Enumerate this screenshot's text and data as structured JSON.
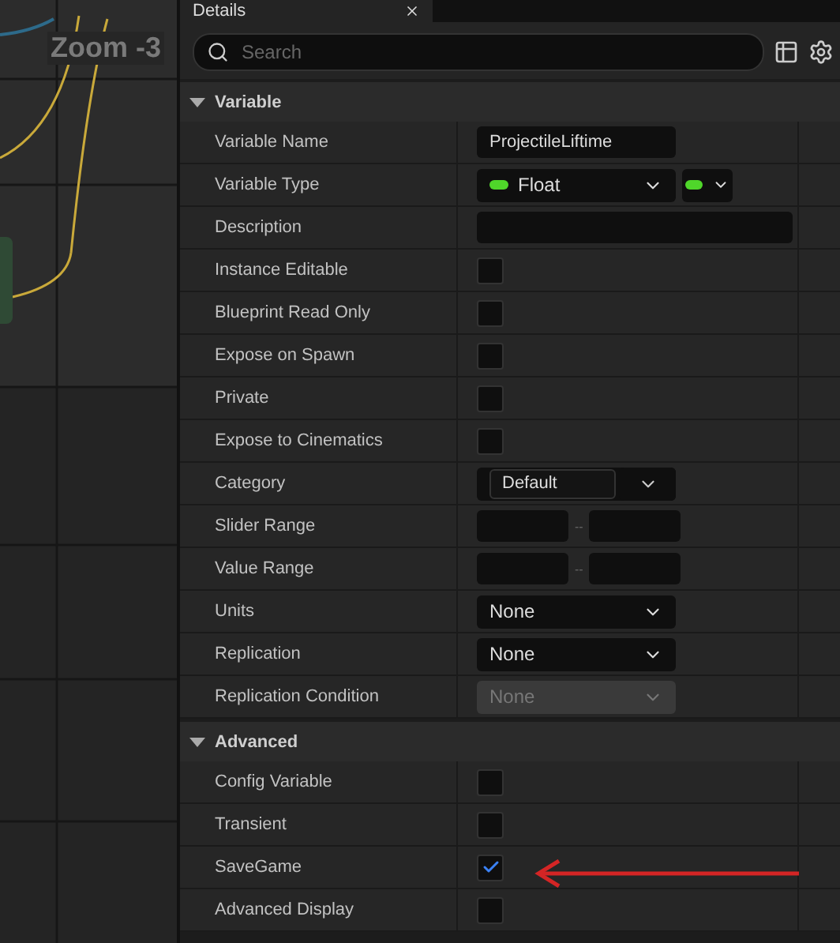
{
  "graph": {
    "zoom_label": "Zoom -3"
  },
  "tab": {
    "title": "Details"
  },
  "search": {
    "placeholder": "Search"
  },
  "sections": [
    {
      "title": "Variable",
      "expanded": true,
      "rows": [
        {
          "label": "Variable Name",
          "kind": "text",
          "value": "ProjectileLiftime"
        },
        {
          "label": "Variable Type",
          "kind": "type",
          "value": "Float",
          "color": "#4fd62a"
        },
        {
          "label": "Description",
          "kind": "wide"
        },
        {
          "label": "Instance Editable",
          "kind": "checkbox",
          "checked": false
        },
        {
          "label": "Blueprint Read Only",
          "kind": "checkbox",
          "checked": false
        },
        {
          "label": "Expose on Spawn",
          "kind": "checkbox",
          "checked": false
        },
        {
          "label": "Private",
          "kind": "checkbox",
          "checked": false
        },
        {
          "label": "Expose to Cinematics",
          "kind": "checkbox",
          "checked": false
        },
        {
          "label": "Category",
          "kind": "combo",
          "value": "Default"
        },
        {
          "label": "Slider Range",
          "kind": "range",
          "separator": "--"
        },
        {
          "label": "Value Range",
          "kind": "range",
          "separator": "--"
        },
        {
          "label": "Units",
          "kind": "dropdown",
          "value": "None",
          "disabled": false
        },
        {
          "label": "Replication",
          "kind": "dropdown",
          "value": "None",
          "disabled": false
        },
        {
          "label": "Replication Condition",
          "kind": "dropdown",
          "value": "None",
          "disabled": true
        }
      ]
    },
    {
      "title": "Advanced",
      "expanded": true,
      "rows": [
        {
          "label": "Config Variable",
          "kind": "checkbox",
          "checked": false
        },
        {
          "label": "Transient",
          "kind": "checkbox",
          "checked": false
        },
        {
          "label": "SaveGame",
          "kind": "checkbox",
          "checked": true
        },
        {
          "label": "Advanced Display",
          "kind": "checkbox",
          "checked": false
        }
      ]
    }
  ]
}
